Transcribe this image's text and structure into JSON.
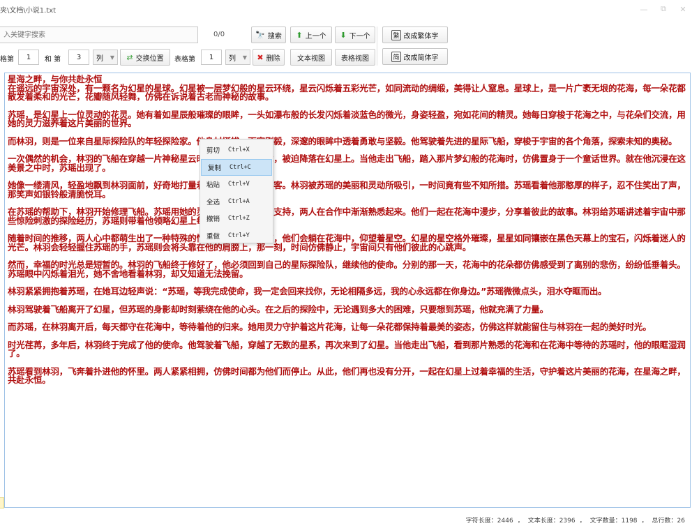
{
  "window": {
    "title": "夹\\文档\\小说1.txt"
  },
  "search": {
    "placeholder": "入关键字搜索",
    "count": "0/0",
    "search_label": "搜索",
    "prev_label": "上一个",
    "next_label": "下一个"
  },
  "convert": {
    "traditional_label": "改成繁体字",
    "traditional_icon": "繁",
    "simplified_label": "改成简体字",
    "simplified_icon": "简"
  },
  "table_tools": {
    "label_prefix": "格第",
    "col1_value": "1",
    "and_label": "和 第",
    "col2_value": "3",
    "unit1": "列",
    "swap_label": "交换位置",
    "table_label": "表格第",
    "col3_value": "1",
    "unit2": "列",
    "delete_label": "删除",
    "text_view_label": "文本视图",
    "table_view_label": "表格视图"
  },
  "context_menu": {
    "items": [
      {
        "label": "剪切",
        "shortcut": "Ctrl+X"
      },
      {
        "label": "复制",
        "shortcut": "Ctrl+C"
      },
      {
        "label": "粘贴",
        "shortcut": "Ctrl+V"
      },
      {
        "label": "全选",
        "shortcut": "Ctrl+A"
      },
      {
        "label": "撤销",
        "shortcut": "Ctrl+Z"
      },
      {
        "label": "重做",
        "shortcut": "Ctrl+Y"
      }
    ]
  },
  "content": {
    "title": "星海之畔，与你共赴永恒",
    "paragraphs": [
      "在遥远的宇宙深处，有一颗名为幻星的星球。幻星被一层梦幻般的星云环绕，星云闪烁着五彩光芒，如同流动的绸缎，美得让人窒息。星球上，是一片广袤无垠的花海，每一朵花都散发着柔和的光芒，花瓣随风轻舞，仿佛在诉说着古老而神秘的故事。",
      "苏瑶，是幻星上一位灵动的花灵。她有着如星辰般璀璨的眼眸，一头如瀑布般的长发闪烁着淡蓝色的微光，身姿轻盈，宛如花间的精灵。她每日穿梭于花海之中，与花朵们交流，用她的灵力滋养着这片美丽的世界。",
      "而林羽，则是一位来自星际探险队的年轻探险家。他身材挺拔，面容刚毅，深邃的眼眸中透着勇敢与坚毅。他驾驶着先进的星际飞船，穿梭于宇宙的各个角落，探索未知的奥秘。",
      "一次偶然的机会，林羽的飞船在穿越一片神秘星云时，突然出现了故障，被迫降落在幻星上。当他走出飞船，踏入那片梦幻般的花海时，仿佛置身于一个童话世界。就在他沉浸在这美景之中时，苏瑶出现了。",
      "她像一缕清风，轻盈地飘到林羽面前，好奇地打量着这位来自异星的访客。林羽被苏瑶的美丽和灵动所吸引，一时间竟有些不知所措。苏瑶看着他那憨厚的样子，忍不住笑出了声，那笑声如银铃般清脆悦耳。",
      "在苏瑶的帮助下，林羽开始修理飞船。苏瑶用她的灵力为林羽提供能量支持，两人在合作中渐渐熟悉起来。他们一起在花海中漫步，分享着彼此的故事。林羽给苏瑶讲述着宇宙中那些惊险刺激的探险经历，苏瑶则带着他领略幻星上每一处独特的风景。",
      "随着时间的推移，两人心中都萌生出了一种特殊的情感。每当夜幕降临，他们会躺在花海中，仰望着星空。幻星的星空格外璀璨，星星如同镶嵌在黑色天幕上的宝石，闪烁着迷人的光芒。林羽会轻轻握住苏瑶的手，苏瑶则会将头靠在他的肩膀上，那一刻，时间仿佛静止，宇宙间只有他们彼此的心跳声。",
      "然而，幸福的时光总是短暂的。林羽的飞船终于修好了，他必须回到自己的星际探险队，继续他的使命。分别的那一天，花海中的花朵都仿佛感受到了离别的悲伤，纷纷低垂着头。苏瑶眼中闪烁着泪光，她不舍地看着林羽，却又知道无法挽留。",
      "林羽紧紧拥抱着苏瑶，在她耳边轻声说：“苏瑶，等我完成使命，我一定会回来找你，无论相隔多远，我的心永远都在你身边。”苏瑶微微点头，泪水夺眶而出。",
      "林羽驾驶着飞船离开了幻星，但苏瑶的身影却时刻萦绕在他的心头。在之后的探险中，无论遇到多大的困难，只要想到苏瑶，他就充满了力量。",
      "而苏瑶，在林羽离开后，每天都守在花海中，等待着他的归来。她用灵力守护着这片花海，让每一朵花都保持着最美的姿态，仿佛这样就能留住与林羽在一起的美好时光。",
      "时光荏苒，多年后，林羽终于完成了他的使命。他驾驶着飞船，穿越了无数的星系，再次来到了幻星。当他走出飞船，看到那片熟悉的花海和在花海中等待的苏瑶时，他的眼眶湿润了。",
      "苏瑶看到林羽，飞奔着扑进他的怀里。两人紧紧相拥，仿佛时间都为他们而停止。从此，他们再也没有分开，一起在幻星上过着幸福的生活，守护着这片美丽的花海，在星海之畔，共赴永恒。"
    ]
  },
  "status": {
    "char_length": "字符长度：2446",
    "text_length": "文本长度：2396",
    "word_count": "文字数量：1198",
    "total_lines": "总行数：26",
    "sep": "，"
  },
  "colors": {
    "text": "#b01010",
    "editor_border": "#9dc1e6",
    "menu_highlight": "#cce4f7"
  }
}
